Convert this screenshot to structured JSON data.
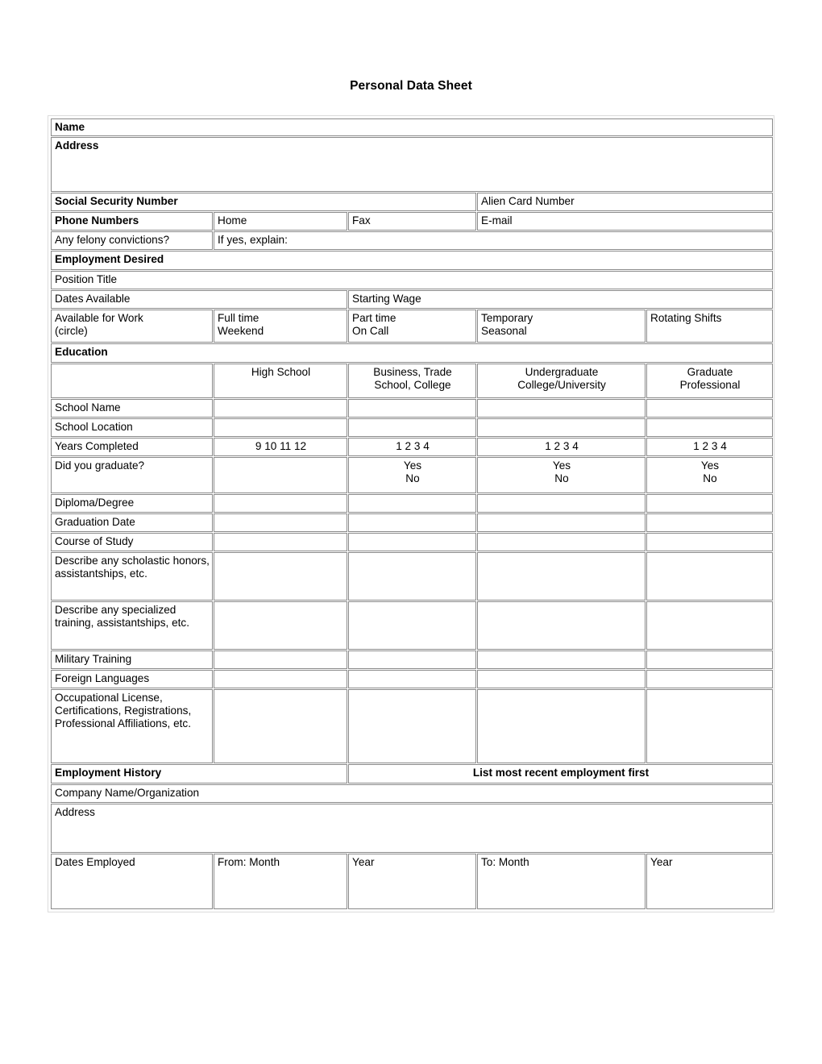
{
  "document": {
    "title": "Personal Data Sheet"
  },
  "colors": {
    "section_header_bg": "#c8c8c8",
    "cell_border": "#8a8a8a",
    "frame_border": "#dcdcdc",
    "page_bg": "#ffffff",
    "text": "#000000"
  },
  "personal": {
    "name_label": "Name",
    "address_label": "Address",
    "ssn_label": "Social Security Number",
    "alien_card_label": "Alien Card Number",
    "phone_numbers_label": "Phone Numbers",
    "home_label": "Home",
    "fax_label": "Fax",
    "email_label": "E-mail",
    "felony_label": "Any felony convictions?",
    "felony_explain_label": "If yes, explain:"
  },
  "employment_desired": {
    "section_label": "Employment Desired",
    "position_title_label": "Position Title",
    "dates_available_label": "Dates Available",
    "starting_wage_label": "Starting Wage",
    "available_for_work_label": "Available for Work\n(circle)",
    "options": [
      "Full time\nWeekend",
      "Part time\nOn Call",
      "Temporary\nSeasonal",
      "Rotating Shifts"
    ]
  },
  "education": {
    "section_label": "Education",
    "column_headers": [
      "",
      "High School",
      "Business, Trade\nSchool, College",
      "Undergraduate\nCollege/University",
      "Graduate\nProfessional"
    ],
    "rows": [
      {
        "label": "School Name",
        "values": [
          "",
          "",
          "",
          ""
        ]
      },
      {
        "label": "School Location",
        "values": [
          "",
          "",
          "",
          ""
        ]
      },
      {
        "label": "Years Completed",
        "values": [
          "9 10 11 12",
          "1 2 3 4",
          "1 2 3 4",
          "1 2 3 4"
        ]
      },
      {
        "label": "Did you graduate?",
        "values": [
          "",
          "Yes\nNo",
          "Yes\nNo",
          "Yes\nNo"
        ]
      },
      {
        "label": "Diploma/Degree",
        "values": [
          "",
          "",
          "",
          ""
        ]
      },
      {
        "label": "Graduation Date",
        "values": [
          "",
          "",
          "",
          ""
        ]
      },
      {
        "label": "Course of Study",
        "values": [
          "",
          "",
          "",
          ""
        ]
      },
      {
        "label": "Describe any scholastic honors, assistantships, etc.",
        "values": [
          "",
          "",
          "",
          ""
        ]
      },
      {
        "label": "Describe any specialized training, assistantships, etc.",
        "values": [
          "",
          "",
          "",
          ""
        ]
      },
      {
        "label": "Military Training",
        "values": [
          "",
          "",
          "",
          ""
        ]
      },
      {
        "label": "Foreign Languages",
        "values": [
          "",
          "",
          "",
          ""
        ]
      },
      {
        "label": "Occupational License, Certifications, Registrations, Professional Affiliations, etc.",
        "values": [
          "",
          "",
          "",
          ""
        ]
      }
    ]
  },
  "employment_history": {
    "section_label": "Employment History",
    "section_note": "List most recent employment first",
    "company_label": "Company Name/Organization",
    "address_label": "Address",
    "dates_employed_label": "Dates Employed",
    "from_month_label": "From: Month",
    "from_year_label": "Year",
    "to_month_label": "To: Month",
    "to_year_label": "Year"
  }
}
